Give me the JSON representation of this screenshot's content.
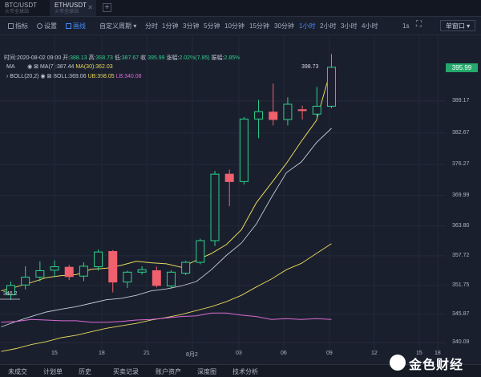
{
  "tabs": [
    {
      "title": "BTC/USDT",
      "subtitle": "火币全球站"
    },
    {
      "title": "ETH/USDT",
      "subtitle": "火币全球站"
    }
  ],
  "toolbar": {
    "indicators": "指标",
    "settings": "设置",
    "draw": "画线",
    "custom_period": "自定义周期",
    "periods": [
      "分时",
      "1分钟",
      "3分钟",
      "5分钟",
      "10分钟",
      "15分钟",
      "30分钟",
      "1小时",
      "2小时",
      "3小时",
      "4小时"
    ],
    "active_period": "1小时",
    "interval_1s": "1s",
    "single_window": "单窗口"
  },
  "legend": {
    "ohlc": {
      "time": "时间:2020-08-02 09:00",
      "open_label": "开:",
      "open": "388.13",
      "high_label": "高:",
      "high": "398.73",
      "low_label": "低:",
      "low": "387.67",
      "close_label": "收:",
      "close": "395.99",
      "change_label": "涨幅:",
      "change": "2.02%(7.85)",
      "amp_label": "振幅:",
      "amp": "2.85%"
    },
    "ma": {
      "label": "MA",
      "ma7": "MA(7):387.44",
      "ma30": "MA(30):362.03"
    },
    "boll": {
      "label": "BOLL(20,2)",
      "boll": "BOLL:369.06",
      "ub": "UB:398.05",
      "lb": "LB:340.08"
    }
  },
  "axis": {
    "y_labels": [
      "389.17",
      "382.67",
      "376.27",
      "369.99",
      "363.80",
      "357.72",
      "351.75",
      "345.87",
      "340.09"
    ],
    "current_price": "395.99",
    "x_labels": [
      "15",
      "18",
      "21",
      "8月2",
      "03",
      "06",
      "09",
      "12",
      "15",
      "18"
    ],
    "max_label": "398.73",
    "min_label": "346.2"
  },
  "colors": {
    "up": "#2fd089",
    "down": "#f0616d",
    "ma7": "#e8d95a",
    "boll_mid": "#c4cad6",
    "boll_ub": "#ffffff",
    "boll_lb": "#e8d95a",
    "rsi": "#d86ad0",
    "bg": "#1a1f2e"
  },
  "chart_data": {
    "type": "candlestick",
    "candles": [
      {
        "o": 349.8,
        "h": 352.5,
        "l": 348.8,
        "c": 351.7
      },
      {
        "o": 351.8,
        "h": 355.6,
        "l": 350.9,
        "c": 353.4
      },
      {
        "o": 353.4,
        "h": 356.6,
        "l": 352.5,
        "c": 354.7
      },
      {
        "o": 354.8,
        "h": 356.8,
        "l": 353.5,
        "c": 355.5
      },
      {
        "o": 355.4,
        "h": 355.9,
        "l": 352.8,
        "c": 353.5
      },
      {
        "o": 353.6,
        "h": 356.4,
        "l": 352.6,
        "c": 355.6
      },
      {
        "o": 355.5,
        "h": 359.0,
        "l": 354.7,
        "c": 358.5
      },
      {
        "o": 358.6,
        "h": 358.9,
        "l": 350.3,
        "c": 352.4
      },
      {
        "o": 352.4,
        "h": 354.7,
        "l": 351.2,
        "c": 354.4
      },
      {
        "o": 354.4,
        "h": 355.6,
        "l": 353.9,
        "c": 354.9
      },
      {
        "o": 354.7,
        "h": 355.5,
        "l": 351.3,
        "c": 351.7
      },
      {
        "o": 351.6,
        "h": 354.8,
        "l": 351.0,
        "c": 354.4
      },
      {
        "o": 354.2,
        "h": 356.7,
        "l": 353.8,
        "c": 356.4
      },
      {
        "o": 356.4,
        "h": 361.2,
        "l": 356.0,
        "c": 360.8
      },
      {
        "o": 360.8,
        "h": 375.0,
        "l": 359.7,
        "c": 374.3
      },
      {
        "o": 374.3,
        "h": 375.2,
        "l": 367.8,
        "c": 372.8
      },
      {
        "o": 372.8,
        "h": 385.9,
        "l": 372.2,
        "c": 385.5
      },
      {
        "o": 385.5,
        "h": 389.4,
        "l": 381.6,
        "c": 387.0
      },
      {
        "o": 386.9,
        "h": 392.7,
        "l": 384.2,
        "c": 385.4
      },
      {
        "o": 385.4,
        "h": 389.9,
        "l": 384.2,
        "c": 388.5
      },
      {
        "o": 387.4,
        "h": 388.2,
        "l": 385.4,
        "c": 387.2
      },
      {
        "o": 386.5,
        "h": 392.0,
        "l": 386.0,
        "c": 388.1
      },
      {
        "o": 388.1,
        "h": 398.7,
        "l": 387.7,
        "c": 396.0
      }
    ],
    "ma7": [
      350.6,
      351.4,
      352.3,
      353.3,
      353.7,
      353.9,
      355.0,
      355.2,
      355.8,
      356.6,
      356.3,
      356.1,
      355.4,
      356.8,
      358.2,
      360.0,
      363.0,
      368.5,
      372.5,
      376.5,
      381.0,
      385.2,
      396.0
    ],
    "boll_mid": [
      343.3,
      344.4,
      345.4,
      346.3,
      346.9,
      347.4,
      348.1,
      348.8,
      349.1,
      349.7,
      350.6,
      351.0,
      351.6,
      352.5,
      354.9,
      357.8,
      360.3,
      364.2,
      369.6,
      374.6,
      376.8,
      380.7,
      383.6
    ],
    "boll_lower": [
      338.3,
      338.9,
      339.7,
      340.3,
      341.1,
      341.6,
      342.3,
      343.0,
      343.5,
      344.0,
      344.7,
      345.2,
      345.8,
      346.6,
      347.4,
      348.4,
      349.7,
      351.4,
      353.0,
      354.9,
      356.2,
      358.2,
      360.2
    ],
    "rsi_line": [
      0.39,
      0.4,
      0.43,
      0.42,
      0.41,
      0.41,
      0.39,
      0.39,
      0.4,
      0.42,
      0.43,
      0.45,
      0.47,
      0.48,
      0.52,
      0.52,
      0.49,
      0.47,
      0.43,
      0.44,
      0.43,
      0.44,
      0.43
    ],
    "ylim": [
      338.0,
      402.5
    ],
    "x_labels": [
      "15",
      "18",
      "21",
      "8月2",
      "03",
      "06",
      "09",
      "12",
      "15",
      "18"
    ]
  },
  "bottom": {
    "items": [
      "未成交",
      "计划单",
      "历史",
      "买卖记录",
      "账户资产",
      "深度图",
      "技术分析"
    ],
    "watermark": "金色财经"
  }
}
